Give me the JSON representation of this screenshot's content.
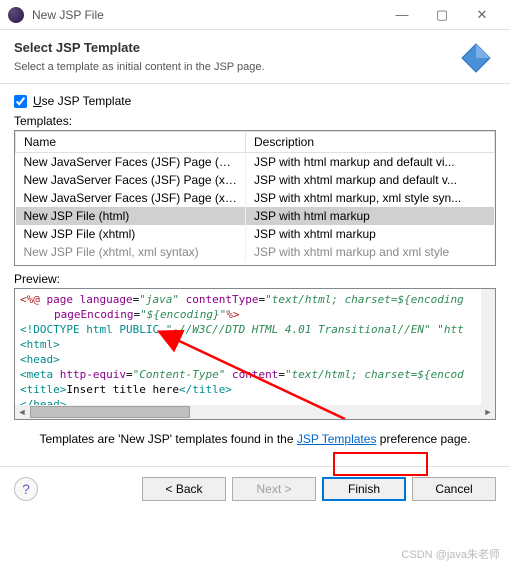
{
  "window": {
    "title": "New JSP File",
    "minimize": "—",
    "maximize": "▢",
    "close": "✕"
  },
  "header": {
    "title": "Select JSP Template",
    "subtitle": "Select a template as initial content in the JSP page."
  },
  "checkbox": {
    "label_pre": "U",
    "label_post": "se JSP Template",
    "checked": true
  },
  "templates_label": "Templates:",
  "table": {
    "col_name": "Name",
    "col_desc": "Description",
    "rows": [
      {
        "name": "New JavaServer Faces (JSF) Page (ht...",
        "desc": "JSP with html markup and default vi..."
      },
      {
        "name": "New JavaServer Faces (JSF) Page (xh...",
        "desc": "JSP with xhtml markup and default v..."
      },
      {
        "name": "New JavaServer Faces (JSF) Page (xh...",
        "desc": "JSP with xhtml markup, xml style syn..."
      },
      {
        "name": "New JSP File (html)",
        "desc": "JSP with html markup",
        "selected": true
      },
      {
        "name": "New JSP File (xhtml)",
        "desc": "JSP with xhtml markup"
      },
      {
        "name": "New JSP File (xhtml, xml syntax)",
        "desc": "JSP with xhtml markup and xml style",
        "faded": true
      }
    ]
  },
  "preview_label": "Preview:",
  "preview": {
    "line1_a": "<%@",
    "line1_b": " page ",
    "line1_c": "language",
    "line1_d": "=",
    "line1_e": "\"java\"",
    "line1_f": " contentType",
    "line1_g": "=",
    "line1_h": "\"text/html; charset=${encoding",
    "line2_a": "pageEncoding",
    "line2_b": "=",
    "line2_c": "\"${encoding}\"",
    "line2_d": "%>",
    "line3_a": "<!DOCTYPE ",
    "line3_b": "html ",
    "line3_c": "PUBLIC ",
    "line3_d": "\"-//W3C//DTD HTML 4.01 Transitional//EN\" \"htt",
    "line4": "<html>",
    "line5": "<head>",
    "line6_a": "<meta ",
    "line6_b": "http-equiv",
    "line6_c": "=",
    "line6_d": "\"Content-Type\"",
    "line6_e": " content",
    "line6_f": "=",
    "line6_g": "\"text/html; charset=${encod",
    "line7_a": "<title>",
    "line7_b": "Insert title here",
    "line7_c": "</title>",
    "line8": "</head>"
  },
  "footer_note_pre": "Templates are 'New JSP' templates found in the ",
  "footer_note_link": "JSP Templates",
  "footer_note_post": " preference page.",
  "buttons": {
    "help": "?",
    "back": "< Back",
    "next": "Next >",
    "finish": "Finish",
    "cancel": "Cancel"
  },
  "watermark": "CSDN @java朱老师"
}
